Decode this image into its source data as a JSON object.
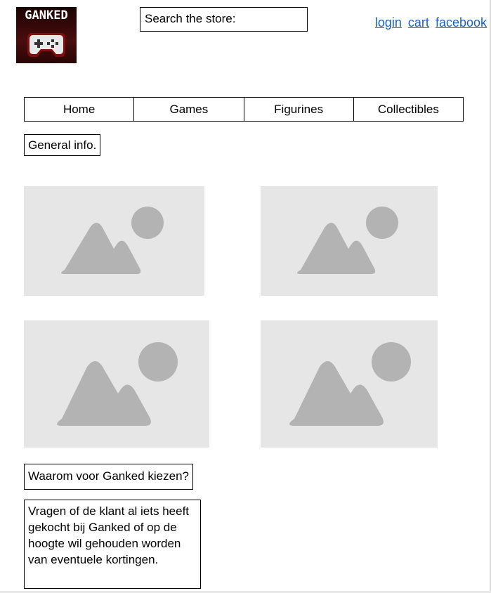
{
  "logo": {
    "text": "GANKED",
    "icon": "gamepad-icon"
  },
  "search": {
    "label": "Search the store:"
  },
  "top_links": {
    "login": "login",
    "cart": "cart",
    "facebook": "facebook"
  },
  "nav": {
    "items": [
      {
        "label": "Home"
      },
      {
        "label": "Games"
      },
      {
        "label": "Figurines"
      },
      {
        "label": "Collectibles"
      }
    ]
  },
  "general_info": {
    "label": "General info."
  },
  "images": {
    "icon": "image-placeholder-icon",
    "count": 4
  },
  "why": {
    "title": "Waarom voor Ganked kiezen?",
    "text": "Vragen of de klant al iets heeft gekocht bij Ganked of op de hoogte wil gehouden worden van eventuele kortingen."
  },
  "colors": {
    "link": "#1a5fd0",
    "placeholder_bg": "#e6e6e6",
    "placeholder_shape": "#b3b3b3",
    "logo_bg": "#3a0a0a",
    "logo_accent": "#e01b1b"
  }
}
